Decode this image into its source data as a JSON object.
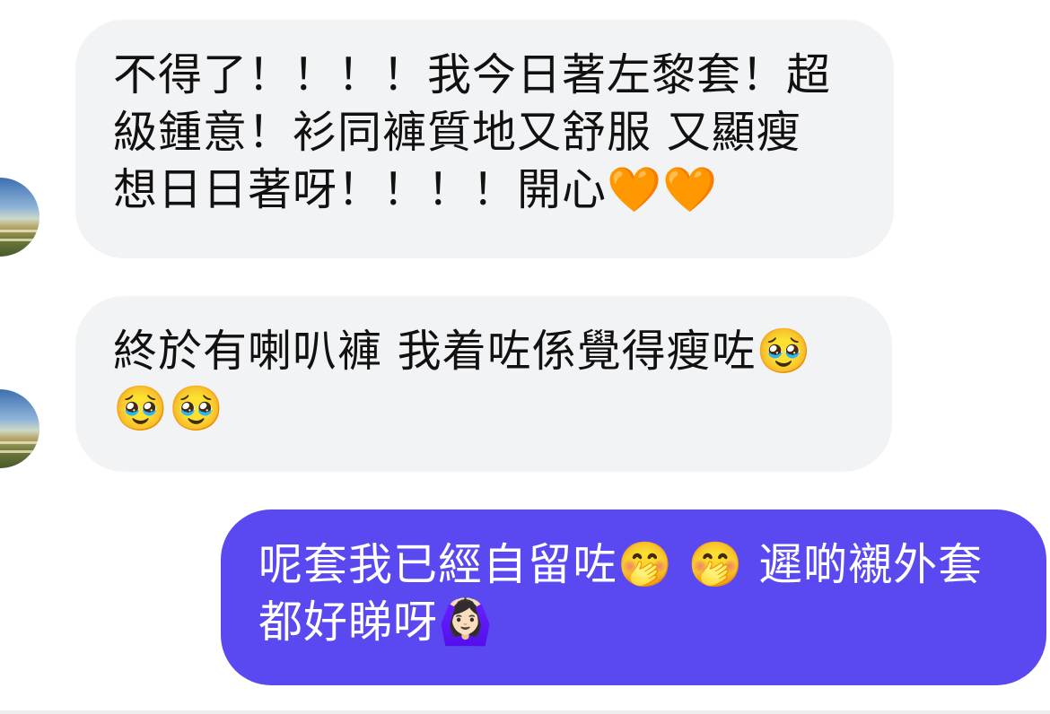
{
  "messages": [
    {
      "direction": "incoming",
      "text": "不得了！！！！我今日著左黎套！超級鍾意！衫同褲質地又舒服 又顯瘦 想日日著呀！！！！開心🧡🧡"
    },
    {
      "direction": "incoming",
      "text": "終於有喇叭褲 我着咗係覺得瘦咗🥹🥹🥹"
    },
    {
      "direction": "outgoing",
      "text": "呢套我已經自留咗🤭 🤭 遲啲襯外套都好睇呀🙆🏻‍♀️"
    }
  ],
  "colors": {
    "incoming_bubble": "#f2f3f5",
    "outgoing_bubble": "#5a48f0",
    "incoming_text": "#111111",
    "outgoing_text": "#ffffff"
  }
}
